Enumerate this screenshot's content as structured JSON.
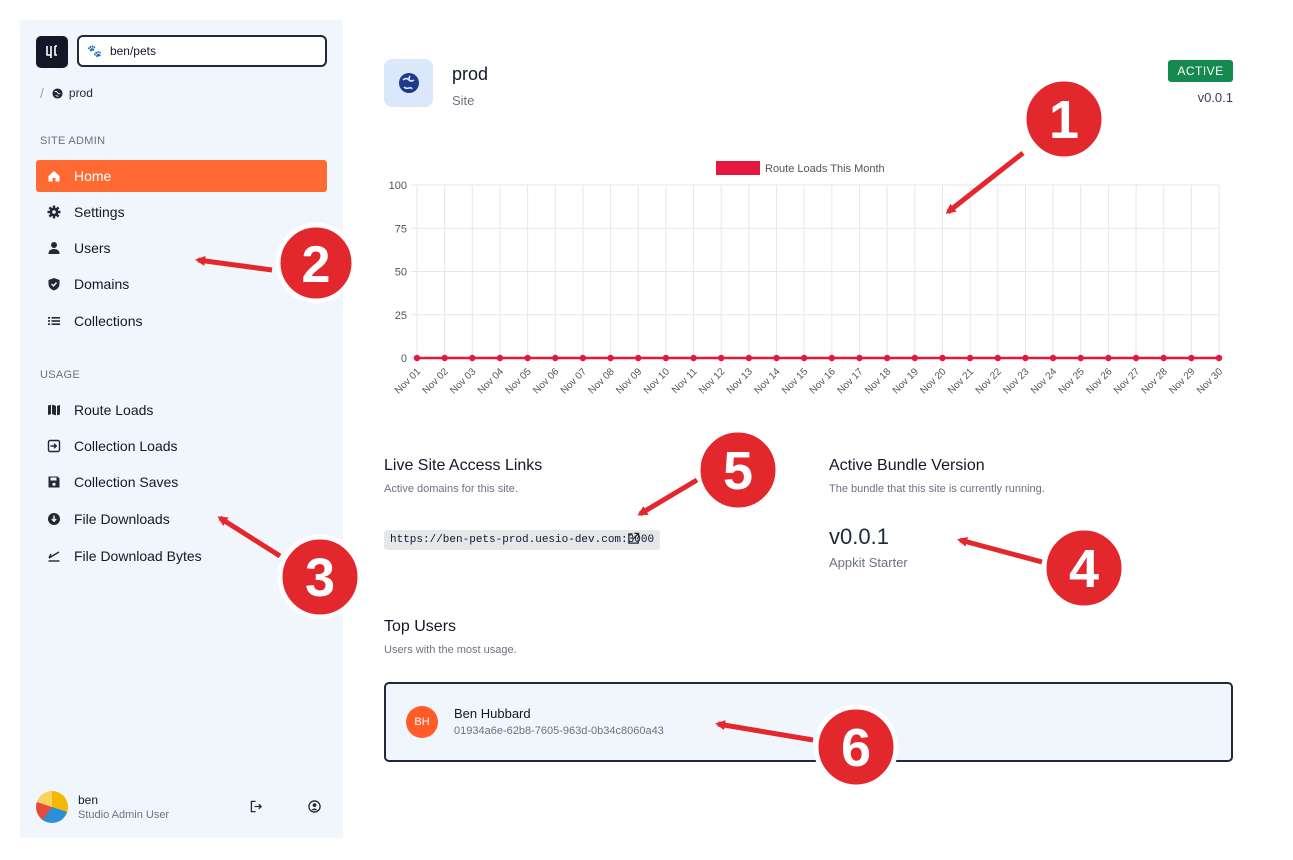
{
  "sidebar": {
    "app_name": "ben/pets",
    "breadcrumb": "prod",
    "site_admin_title": "SITE ADMIN",
    "admin_items": [
      {
        "label": "Home",
        "icon": "home-icon",
        "active": true
      },
      {
        "label": "Settings",
        "icon": "gear-icon"
      },
      {
        "label": "Users",
        "icon": "person-icon"
      },
      {
        "label": "Domains",
        "icon": "shield-icon"
      },
      {
        "label": "Collections",
        "icon": "list-icon"
      }
    ],
    "usage_title": "USAGE",
    "usage_items": [
      {
        "label": "Route Loads",
        "icon": "map-icon"
      },
      {
        "label": "Collection Loads",
        "icon": "login-icon"
      },
      {
        "label": "Collection Saves",
        "icon": "save-icon"
      },
      {
        "label": "File Downloads",
        "icon": "download-circle-icon"
      },
      {
        "label": "File Download Bytes",
        "icon": "check-underline-icon"
      }
    ],
    "footer": {
      "name": "ben",
      "role": "Studio Admin User"
    }
  },
  "header": {
    "site_name": "prod",
    "site_type": "Site",
    "status": "ACTIVE",
    "version": "v0.0.1"
  },
  "chart_data": {
    "type": "line",
    "legend": "Route Loads This Month",
    "categories": [
      "Nov 01",
      "Nov 02",
      "Nov 03",
      "Nov 04",
      "Nov 05",
      "Nov 06",
      "Nov 07",
      "Nov 08",
      "Nov 09",
      "Nov 10",
      "Nov 11",
      "Nov 12",
      "Nov 13",
      "Nov 14",
      "Nov 15",
      "Nov 16",
      "Nov 17",
      "Nov 18",
      "Nov 19",
      "Nov 20",
      "Nov 21",
      "Nov 22",
      "Nov 23",
      "Nov 24",
      "Nov 25",
      "Nov 26",
      "Nov 27",
      "Nov 28",
      "Nov 29",
      "Nov 30"
    ],
    "series": [
      {
        "name": "Route Loads This Month",
        "values": [
          0,
          0,
          0,
          0,
          0,
          0,
          0,
          0,
          0,
          0,
          0,
          0,
          0,
          0,
          0,
          0,
          0,
          0,
          0,
          0,
          0,
          0,
          0,
          0,
          0,
          0,
          0,
          0,
          0,
          0
        ]
      }
    ],
    "yticks": [
      0,
      25,
      50,
      75,
      100
    ],
    "ylim": [
      0,
      100
    ],
    "grid": true,
    "legend_position": "top",
    "color": "#e3173f"
  },
  "links": {
    "title": "Live Site Access Links",
    "desc": "Active domains for this site.",
    "url": "https://ben-pets-prod.uesio-dev.com:3000"
  },
  "bundle": {
    "title": "Active Bundle Version",
    "desc": "The bundle that this site is currently running.",
    "version": "v0.0.1",
    "name": "Appkit Starter"
  },
  "top_users": {
    "title": "Top Users",
    "desc": "Users with the most usage.",
    "users": [
      {
        "initials": "BH",
        "name": "Ben Hubbard",
        "id": "01934a6e-62b8-7605-963d-0b34c8060a43"
      }
    ]
  },
  "annotations": [
    "1",
    "2",
    "3",
    "4",
    "5",
    "6"
  ],
  "colors": {
    "accent": "#ff6a33",
    "active_badge": "#15894f",
    "annotation": "#e3282d"
  }
}
